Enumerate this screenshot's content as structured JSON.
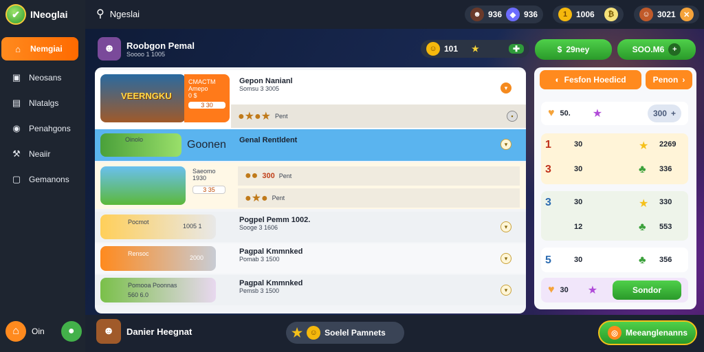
{
  "brand": {
    "name": "INeoglai"
  },
  "search": {
    "label": "Ngeslai"
  },
  "sidebar": {
    "items": [
      {
        "label": "Nemgiai",
        "icon": "home-icon"
      },
      {
        "label": "Neosans",
        "icon": "bag-icon"
      },
      {
        "label": "Nlatalgs",
        "icon": "shop-icon"
      },
      {
        "label": "Penahgons",
        "icon": "compass-icon"
      },
      {
        "label": "Neaiir",
        "icon": "tools-icon"
      },
      {
        "label": "Gemanons",
        "icon": "settings-icon"
      }
    ],
    "bottom_label": "Oin"
  },
  "topbar": {
    "gems": "936",
    "coins": "1006",
    "badge": "₿",
    "coins2": "1006",
    "level": "3021"
  },
  "player": {
    "name": "Roobgon Pemal",
    "sub": "Soooo 1 1005"
  },
  "stats": {
    "smile": "101",
    "stars_label": "",
    "btn1": "29ney",
    "btn2": "SOO.M6"
  },
  "rows": [
    {
      "title": "Gepon Nanianl",
      "sub": "Somsu 3 3005",
      "tag": "CMACTM",
      "tag2": "Amepo",
      "tag3": "0 $",
      "price": "3 30",
      "banner": "VEERNGKU",
      "foot": "Pent"
    },
    {
      "title": "Genal Rentldent",
      "sub": "",
      "tag": "Oinolo",
      "tag2": "Goonen",
      "price": ""
    },
    {
      "title": "",
      "sub": "",
      "tag": "Saeomo",
      "tag2": "1930",
      "price": "3 35",
      "mid": "300",
      "midlabel": "Pent",
      "foot": "Pent"
    },
    {
      "title": "Pogpel Pemm 1002.",
      "sub": "Sooge 3 1606",
      "tag": "Pocmot",
      "tag2": "1005 1"
    },
    {
      "title": "Pagpal Kmmnked",
      "sub": "Pomab 3 1500",
      "tag": "Rensoc",
      "tag2": "2000"
    },
    {
      "title": "Pagpal Kmmnked",
      "sub": "Pemsb 3 1500",
      "tag": "Pomooa Poonnas",
      "tag2": "560 6.0"
    }
  ],
  "right": {
    "tab1": "Fesfon Hoedicd",
    "tab2": "Penon",
    "top": {
      "a": "50.",
      "b": "300"
    },
    "cards": [
      {
        "n": "1",
        "v1": "30",
        "v2": "2269",
        "v3": "30",
        "v4": "336",
        "n2": "3"
      },
      {
        "n": "3",
        "v1": "30",
        "v2": "330",
        "v3": "12",
        "v4": "553"
      },
      {
        "n": "5",
        "v1": "30",
        "v2": "356"
      }
    ],
    "footer_val": "30",
    "footer_btn": "Sondor"
  },
  "bottom": {
    "name": "Danier Heegnat",
    "sub": "",
    "center": "Soelel Pamnets",
    "cta": "Meeanglenanns"
  }
}
